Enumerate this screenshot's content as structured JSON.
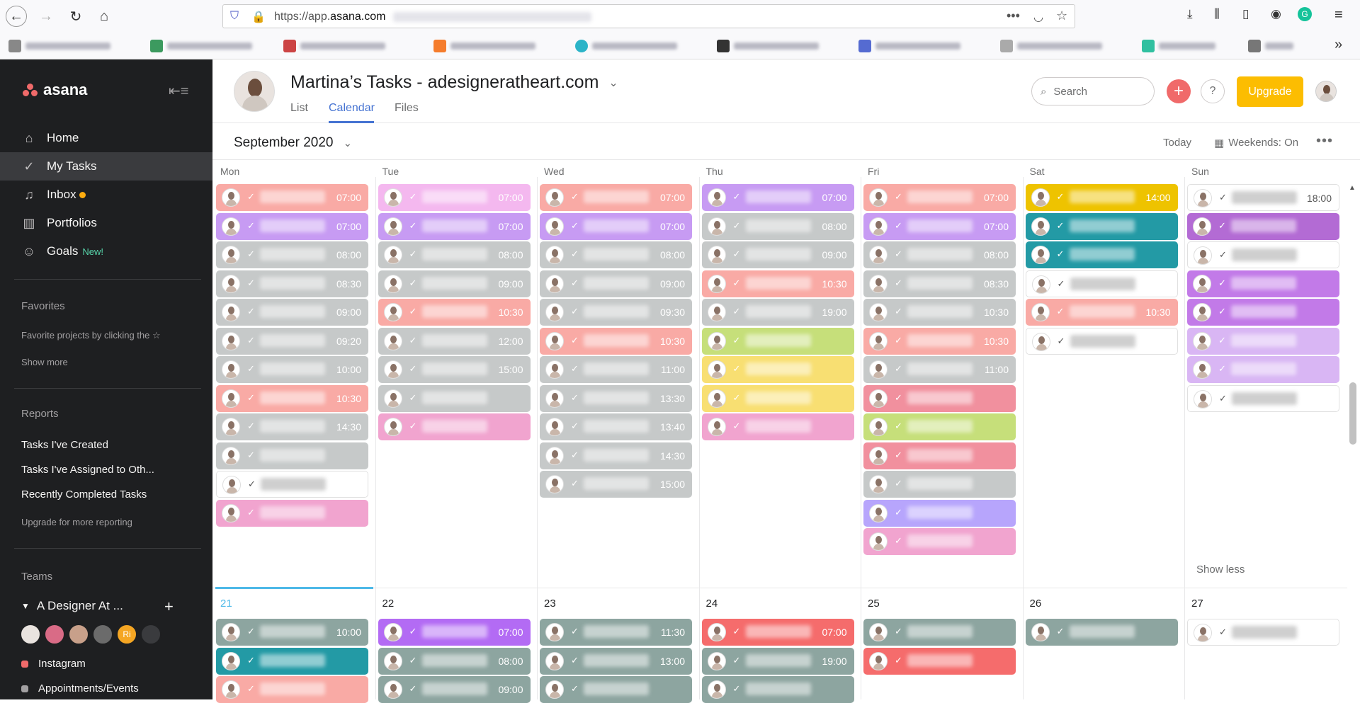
{
  "browser": {
    "url_prefix": "https://app.",
    "url_domain": "asana.com"
  },
  "sidebar": {
    "logo": "asana",
    "nav": [
      {
        "label": "Home",
        "icon": "home-icon"
      },
      {
        "label": "My Tasks",
        "icon": "check-circle-icon"
      },
      {
        "label": "Inbox",
        "icon": "bell-icon"
      },
      {
        "label": "Portfolios",
        "icon": "bar-chart-icon"
      },
      {
        "label": "Goals",
        "icon": "person-icon",
        "badge": "New!"
      }
    ],
    "favorites": {
      "heading": "Favorites",
      "hint": "Favorite projects by clicking the",
      "show_more": "Show more"
    },
    "reports": {
      "heading": "Reports",
      "items": [
        "Tasks I've Created",
        "Tasks I've Assigned to Oth...",
        "Recently Completed Tasks"
      ],
      "upgrade": "Upgrade for more reporting"
    },
    "teams": {
      "heading": "Teams",
      "team_name": "A Designer At ...",
      "avatar_initials": "Ri",
      "projects": [
        {
          "name": "Instagram",
          "color": "#f06a6a"
        },
        {
          "name": "Appointments/Events",
          "color": "#a2a0a2"
        }
      ]
    }
  },
  "header": {
    "title": "Martina’s Tasks - adesigneratheart.com",
    "tabs": [
      "List",
      "Calendar",
      "Files"
    ],
    "active_tab": "Calendar",
    "search_placeholder": "Search",
    "upgrade_label": "Upgrade",
    "help_label": "?"
  },
  "toolbar": {
    "month": "September 2020",
    "today": "Today",
    "weekends": "Weekends: On"
  },
  "calendar": {
    "days": [
      "Mon",
      "Tue",
      "Wed",
      "Thu",
      "Fri",
      "Sat",
      "Sun"
    ],
    "show_less": "Show less",
    "week1": {
      "Mon": [
        {
          "time": "07:00",
          "color": "#f9aaa5"
        },
        {
          "time": "07:00",
          "color": "#c79bf3"
        },
        {
          "time": "08:00",
          "color": "#c6c9c9"
        },
        {
          "time": "08:30",
          "color": "#c6c9c9"
        },
        {
          "time": "09:00",
          "color": "#c6c9c9"
        },
        {
          "time": "09:20",
          "color": "#c6c9c9"
        },
        {
          "time": "10:00",
          "color": "#c6c9c9"
        },
        {
          "time": "10:30",
          "color": "#f9aaa5"
        },
        {
          "time": "14:30",
          "color": "#c6c9c9"
        },
        {
          "time": "",
          "color": "#c6c9c9"
        },
        {
          "time": "",
          "color": "white"
        },
        {
          "time": "",
          "color": "#f1a4cf"
        }
      ],
      "Tue": [
        {
          "time": "07:00",
          "color": "#f4b8ef"
        },
        {
          "time": "07:00",
          "color": "#c79bf3"
        },
        {
          "time": "08:00",
          "color": "#c6c9c9"
        },
        {
          "time": "09:00",
          "color": "#c6c9c9"
        },
        {
          "time": "10:30",
          "color": "#f9aaa5"
        },
        {
          "time": "12:00",
          "color": "#c6c9c9"
        },
        {
          "time": "15:00",
          "color": "#c6c9c9"
        },
        {
          "time": "",
          "color": "#c6c9c9"
        },
        {
          "time": "",
          "color": "#f1a4cf"
        }
      ],
      "Wed": [
        {
          "time": "07:00",
          "color": "#f9aaa5"
        },
        {
          "time": "07:00",
          "color": "#c79bf3"
        },
        {
          "time": "08:00",
          "color": "#c6c9c9"
        },
        {
          "time": "09:00",
          "color": "#c6c9c9"
        },
        {
          "time": "09:30",
          "color": "#c6c9c9"
        },
        {
          "time": "10:30",
          "color": "#f9aaa5"
        },
        {
          "time": "11:00",
          "color": "#c6c9c9"
        },
        {
          "time": "13:30",
          "color": "#c6c9c9"
        },
        {
          "time": "13:40",
          "color": "#c6c9c9"
        },
        {
          "time": "14:30",
          "color": "#c6c9c9"
        },
        {
          "time": "15:00",
          "color": "#c6c9c9"
        }
      ],
      "Thu": [
        {
          "time": "07:00",
          "color": "#c79bf3"
        },
        {
          "time": "08:00",
          "color": "#c6c9c9"
        },
        {
          "time": "09:00",
          "color": "#c6c9c9"
        },
        {
          "time": "10:30",
          "color": "#f9aaa5"
        },
        {
          "time": "19:00",
          "color": "#c6c9c9"
        },
        {
          "time": "",
          "color": "#c6df7a"
        },
        {
          "time": "",
          "color": "#f8df72"
        },
        {
          "time": "",
          "color": "#f8df72"
        },
        {
          "time": "",
          "color": "#f1a4cf"
        }
      ],
      "Fri": [
        {
          "time": "07:00",
          "color": "#f9aaa5"
        },
        {
          "time": "07:00",
          "color": "#c79bf3"
        },
        {
          "time": "08:00",
          "color": "#c6c9c9"
        },
        {
          "time": "08:30",
          "color": "#c6c9c9"
        },
        {
          "time": "10:30",
          "color": "#c6c9c9"
        },
        {
          "time": "10:30",
          "color": "#f9aaa5"
        },
        {
          "time": "11:00",
          "color": "#c6c9c9"
        },
        {
          "time": "",
          "color": "#f1909e"
        },
        {
          "time": "",
          "color": "#c6df7a"
        },
        {
          "time": "",
          "color": "#f1909e"
        },
        {
          "time": "",
          "color": "#c6c9c9"
        },
        {
          "time": "",
          "color": "#b7a5fc"
        },
        {
          "time": "",
          "color": "#f1a4cf"
        },
        {
          "time": "",
          "color": "#f1a4cf"
        }
      ],
      "Sat": [
        {
          "time": "14:00",
          "color": "#eec300"
        },
        {
          "time": "",
          "color": "#239aa5"
        },
        {
          "time": "",
          "color": "#239aa5"
        },
        {
          "time": "",
          "color": "white"
        },
        {
          "time": "10:30",
          "color": "#f9aaa5"
        },
        {
          "time": "",
          "color": "white"
        }
      ],
      "Sun": [
        {
          "time": "18:00",
          "color": "white"
        },
        {
          "time": "",
          "color": "#b36bd4"
        },
        {
          "time": "",
          "color": "white"
        },
        {
          "time": "",
          "color": "#c27ae8"
        },
        {
          "time": "",
          "color": "#c27ae8"
        },
        {
          "time": "",
          "color": "#d9b6f4"
        },
        {
          "time": "",
          "color": "#d9b6f4"
        },
        {
          "time": "",
          "color": "white"
        }
      ]
    },
    "week2": {
      "dates": [
        "21",
        "22",
        "23",
        "24",
        "25",
        "26",
        "27"
      ],
      "Mon": [
        {
          "time": "10:00",
          "color": "#8da5a0"
        },
        {
          "time": "",
          "color": "#239aa5"
        },
        {
          "time": "",
          "color": "#f9aaa5"
        }
      ],
      "Tue": [
        {
          "time": "07:00",
          "color": "#b36bf4"
        },
        {
          "time": "08:00",
          "color": "#8da5a0"
        },
        {
          "time": "09:00",
          "color": "#8da5a0"
        }
      ],
      "Wed": [
        {
          "time": "11:30",
          "color": "#8da5a0"
        },
        {
          "time": "13:00",
          "color": "#8da5a0"
        },
        {
          "time": "",
          "color": "#8da5a0"
        }
      ],
      "Thu": [
        {
          "time": "07:00",
          "color": "#f56c6c"
        },
        {
          "time": "19:00",
          "color": "#8da5a0"
        },
        {
          "time": "",
          "color": "#8da5a0"
        }
      ],
      "Fri": [
        {
          "time": "",
          "color": "#8da5a0"
        },
        {
          "time": "",
          "color": "#f56c6c"
        }
      ],
      "Sat": [
        {
          "time": "",
          "color": "#8da5a0"
        }
      ],
      "Sun": [
        {
          "time": "",
          "color": "white"
        }
      ]
    }
  }
}
